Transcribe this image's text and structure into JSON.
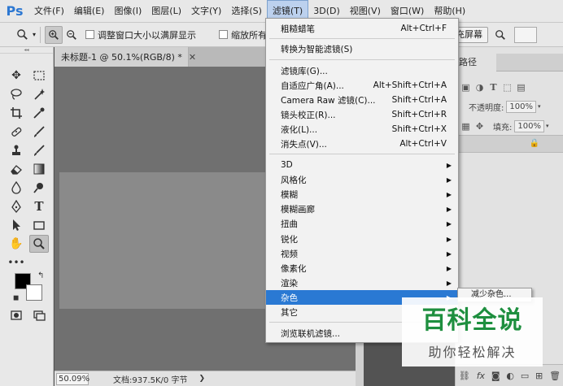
{
  "app": {
    "logo": "Ps"
  },
  "menubar": {
    "items": [
      "文件(F)",
      "编辑(E)",
      "图像(I)",
      "图层(L)",
      "文字(Y)",
      "选择(S)",
      "滤镜(T)",
      "3D(D)",
      "视图(V)",
      "窗口(W)",
      "帮助(H)"
    ],
    "active": "滤镜(T)"
  },
  "options": {
    "chk_resize": "调整窗口大小以满屏显示",
    "chk_zoom_all": "缩放所有",
    "fill_screen": "填充屏幕"
  },
  "document": {
    "tab_title": "未标题-1 @ 50.1%(RGB/8) *",
    "zoom": "50.09%",
    "info": "文档:937.5K/0 字节"
  },
  "layers": {
    "tab": "路径",
    "opacity_label": "不透明度:",
    "opacity_value": "100%",
    "fill_label": "填充:",
    "fill_value": "100%"
  },
  "filter_menu": {
    "groups": [
      [
        {
          "label": "粗糙蜡笔",
          "shortcut": "Alt+Ctrl+F"
        }
      ],
      [
        {
          "label": "转换为智能滤镜(S)",
          "shortcut": ""
        }
      ],
      [
        {
          "label": "滤镜库(G)...",
          "shortcut": ""
        },
        {
          "label": "自适应广角(A)...",
          "shortcut": "Alt+Shift+Ctrl+A"
        },
        {
          "label": "Camera Raw 滤镜(C)...",
          "shortcut": "Shift+Ctrl+A"
        },
        {
          "label": "镜头校正(R)...",
          "shortcut": "Shift+Ctrl+R"
        },
        {
          "label": "液化(L)...",
          "shortcut": "Shift+Ctrl+X"
        },
        {
          "label": "消失点(V)...",
          "shortcut": "Alt+Ctrl+V"
        }
      ],
      [
        {
          "label": "3D",
          "submenu": true
        },
        {
          "label": "风格化",
          "submenu": true
        },
        {
          "label": "模糊",
          "submenu": true
        },
        {
          "label": "模糊画廊",
          "submenu": true
        },
        {
          "label": "扭曲",
          "submenu": true
        },
        {
          "label": "锐化",
          "submenu": true
        },
        {
          "label": "视频",
          "submenu": true
        },
        {
          "label": "像素化",
          "submenu": true
        },
        {
          "label": "渲染",
          "submenu": true
        },
        {
          "label": "杂色",
          "submenu": true,
          "highlighted": true
        },
        {
          "label": "其它",
          "submenu": true
        }
      ],
      [
        {
          "label": "浏览联机滤镜...",
          "shortcut": ""
        }
      ]
    ]
  },
  "submenu": {
    "first_item": "减少杂色..."
  },
  "watermark": {
    "title": "百科全说",
    "subtitle": "助你轻松解决"
  },
  "colors": {
    "accent": "#2a79d3",
    "ps_blue": "#2d78d2",
    "watermark_green": "#1e8f3f"
  }
}
